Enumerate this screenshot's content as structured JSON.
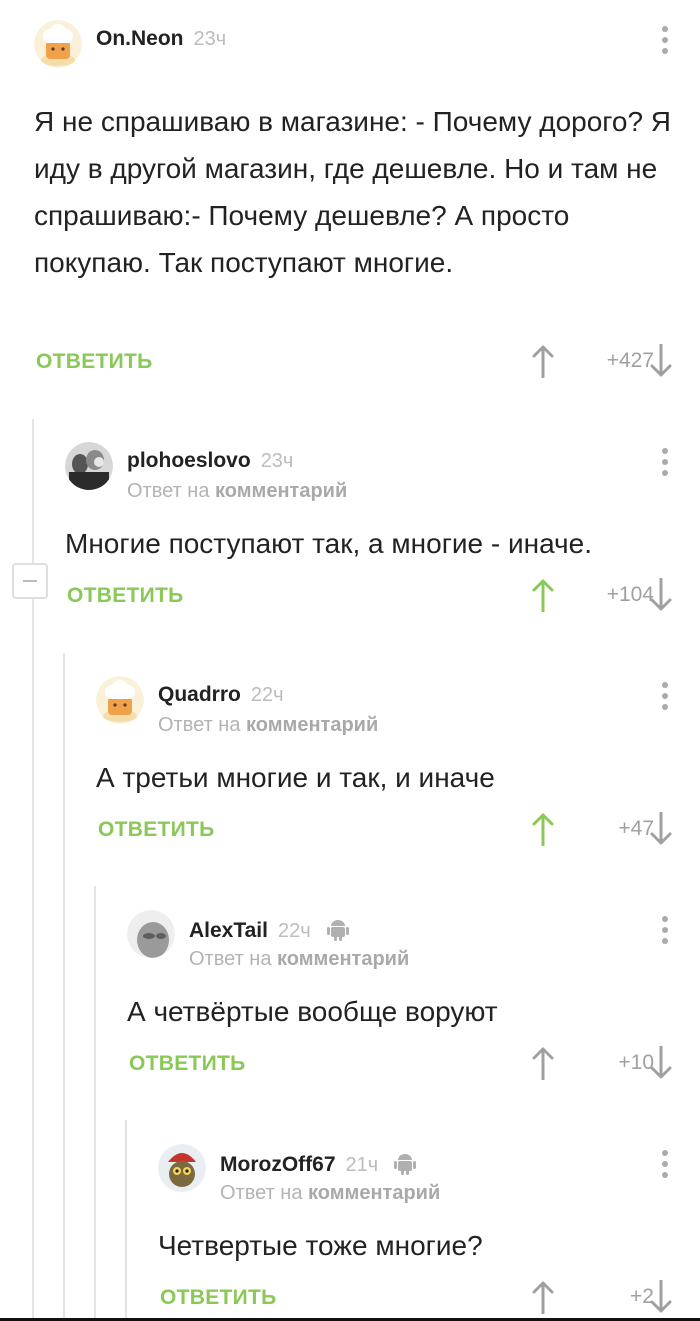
{
  "reply_label": "ОТВЕТИТЬ",
  "reply_to_prefix": "Ответ на",
  "reply_to_target": "комментарий",
  "colors": {
    "accent_green": "#8ac858",
    "up_active": "#8ac858",
    "icon_grey": "#a0a0a0"
  },
  "comments": [
    {
      "author": "On.Neon",
      "time": "23ч",
      "avatar": "chef-hat-avatar",
      "text": "Я не спрашиваю в магазине: - Почему дорого? Я иду в другой магазин, где дешевле. Но и там не спрашиваю:- Почему дешевле? А просто покупаю. Так поступают многие.",
      "score": "+427",
      "upvoted": false
    },
    {
      "author": "plohoeslovo",
      "time": "23ч",
      "avatar": "photo-avatar",
      "text": "Многие поступают так, а многие - иначе.",
      "score": "+104",
      "upvoted": true
    },
    {
      "author": "Quadrro",
      "time": "22ч",
      "avatar": "chef-hat-avatar",
      "text": "А третьи многие и так, и иначе",
      "score": "+47",
      "upvoted": true
    },
    {
      "author": "AlexTail",
      "time": "22ч",
      "avatar": "face-avatar",
      "app_icon": "android-icon",
      "text": "А четвёртые вообще воруют",
      "score": "+10",
      "upvoted": false
    },
    {
      "author": "MorozOff67",
      "time": "21ч",
      "avatar": "creature-avatar",
      "app_icon": "android-icon",
      "text": "Четвертые тоже многие?",
      "score": "+2",
      "upvoted": false
    }
  ]
}
